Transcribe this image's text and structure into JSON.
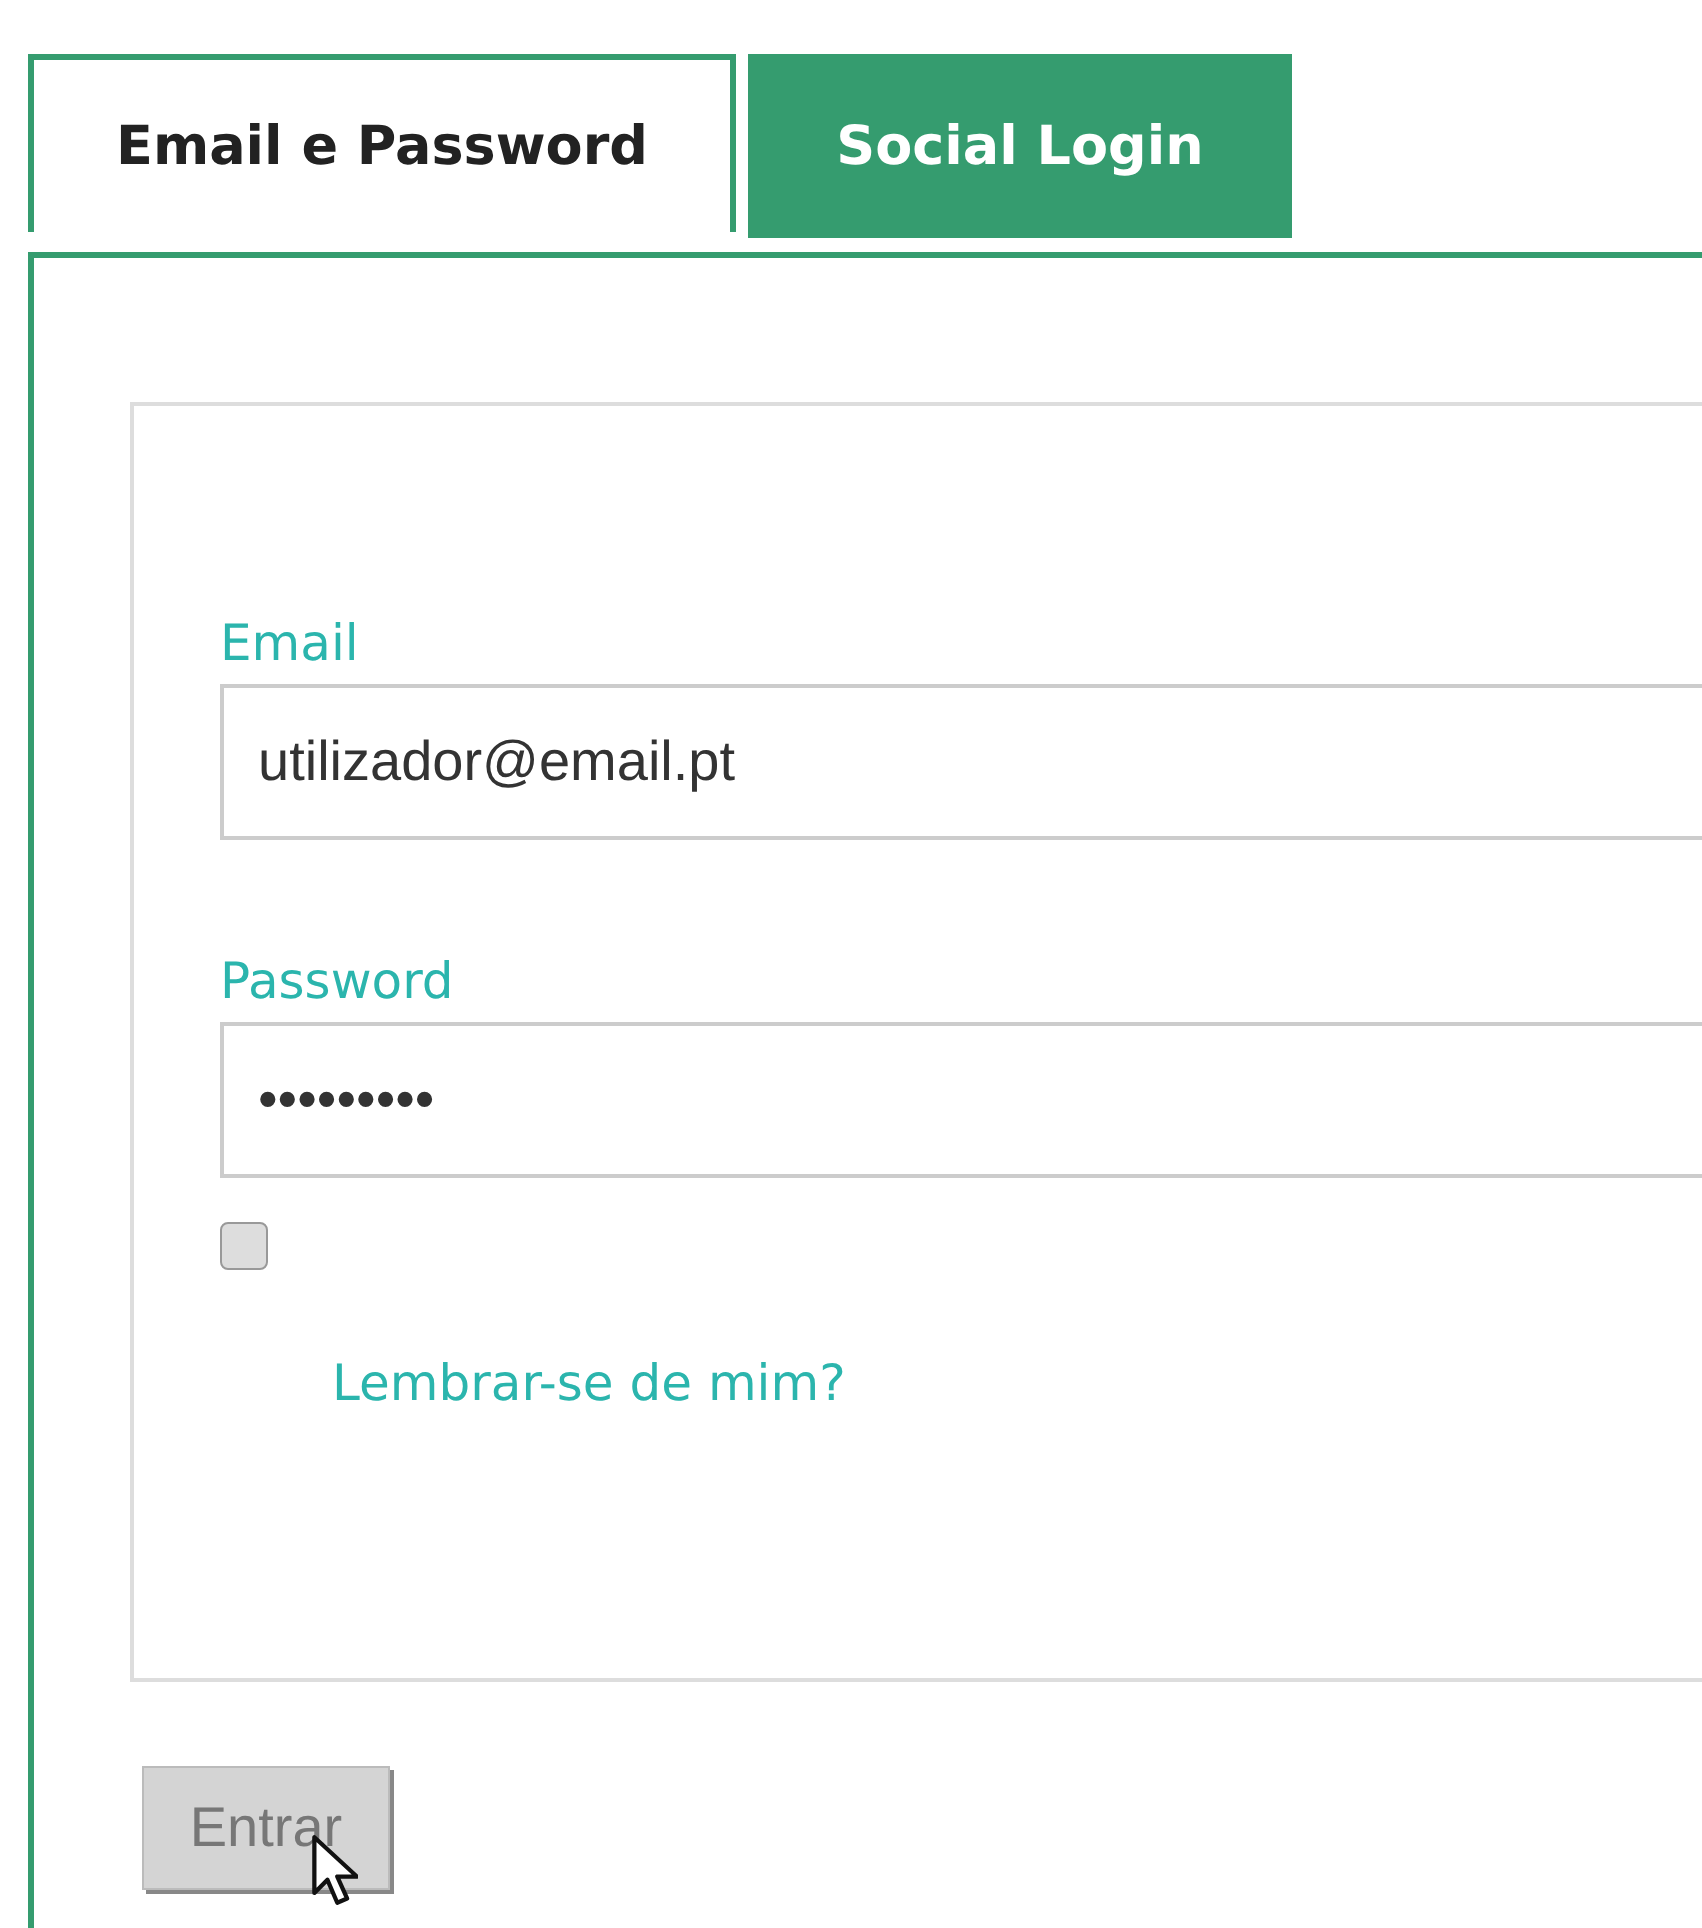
{
  "tabs": [
    {
      "label": "Email e Password",
      "selected": true
    },
    {
      "label": "Social Login",
      "selected": false
    }
  ],
  "form": {
    "fields": [
      {
        "label": "Email",
        "value": "utilizador@email.pt"
      },
      {
        "label": "Password",
        "value": "•••••••••"
      }
    ],
    "remember": {
      "label": "Lembrar-se de mim?",
      "checked": false
    },
    "submit": {
      "label": "Entrar",
      "disabled": true
    }
  }
}
